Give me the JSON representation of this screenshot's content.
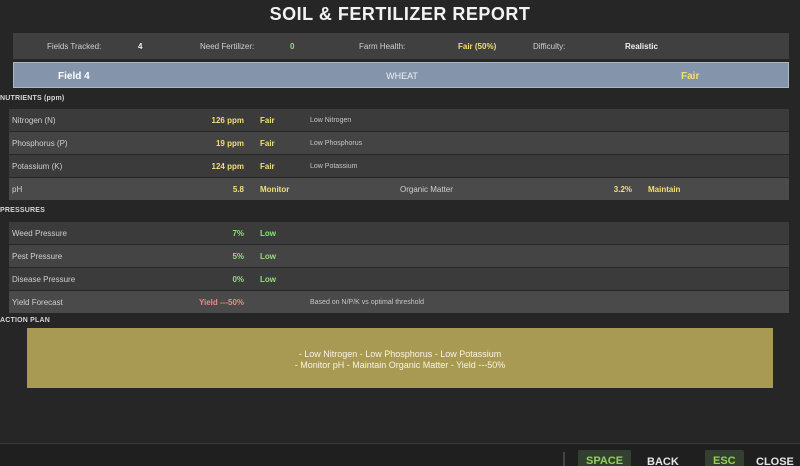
{
  "title": "SOIL & FERTILIZER REPORT",
  "summary": {
    "fields_label": "Fields Tracked:",
    "fields_value": "4",
    "need_label": "Need Fertilizer:",
    "need_value": "0",
    "health_label": "Farm Health:",
    "health_value": "Fair (50%)",
    "difficulty_label": "Difficulty:",
    "difficulty_value": "Realistic"
  },
  "field": {
    "name": "Field 4",
    "crop": "WHEAT",
    "status": "Fair"
  },
  "nutrients": {
    "header": "NUTRIENTS (ppm)",
    "rows": [
      {
        "label": "Nitrogen (N)",
        "value": "126 ppm",
        "status": "Fair",
        "note": "Low Nitrogen"
      },
      {
        "label": "Phosphorus (P)",
        "value": "19 ppm",
        "status": "Fair",
        "note": "Low Phosphorus"
      },
      {
        "label": "Potassium (K)",
        "value": "124 ppm",
        "status": "Fair",
        "note": "Low Potassium"
      }
    ],
    "ph": {
      "label": "pH",
      "value": "5.8",
      "status": "Monitor",
      "om_label": "Organic Matter",
      "om_value": "3.2%",
      "om_status": "Maintain"
    }
  },
  "pressures": {
    "header": "PRESSURES",
    "rows": [
      {
        "label": "Weed Pressure",
        "value": "7%",
        "status": "Low"
      },
      {
        "label": "Pest Pressure",
        "value": "5%",
        "status": "Low"
      },
      {
        "label": "Disease Pressure",
        "value": "0%",
        "status": "Low"
      }
    ],
    "yield": {
      "label": "Yield Forecast",
      "value": "Yield ---50%",
      "note": "Based on N/P/K vs optimal threshold"
    }
  },
  "action_plan": {
    "header": "ACTION PLAN",
    "line1": "- Low Nitrogen   - Low Phosphorus   - Low Potassium",
    "line2": "- Monitor pH   - Maintain Organic Matter   - Yield ---50%"
  },
  "footer": {
    "back_key": "SPACE",
    "back_label": "BACK",
    "close_key": "ESC",
    "close_label": "CLOSE"
  },
  "colors": {
    "background": "#262626",
    "field_bar": "#8495ab",
    "good": "#8fe07a",
    "warning": "#f2df77",
    "bad": "#ec8a86",
    "action_panel": "#a89a52",
    "key_accent": "#92cf5a"
  }
}
